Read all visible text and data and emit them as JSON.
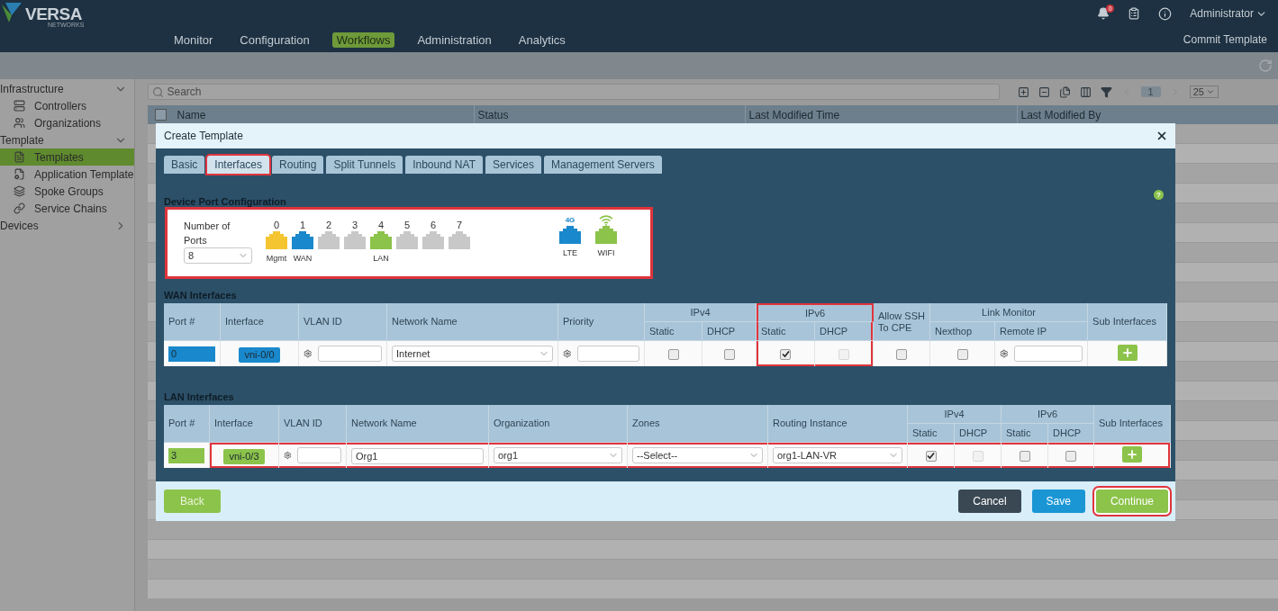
{
  "header": {
    "logo": "VERSA",
    "logo_sub": "NETWORKS",
    "notification_count": "0",
    "user": "Administrator",
    "commit": "Commit Template",
    "nav": [
      {
        "label": "Monitor",
        "selected": false
      },
      {
        "label": "Configuration",
        "selected": false
      },
      {
        "label": "Workflows",
        "selected": true
      },
      {
        "label": "Administration",
        "selected": false
      },
      {
        "label": "Analytics",
        "selected": false
      }
    ]
  },
  "sidebar": [
    {
      "label": "Infrastructure",
      "expanded": true,
      "children": [
        {
          "label": "Controllers",
          "kind": "controllers",
          "selected": false
        },
        {
          "label": "Organizations",
          "kind": "organizations",
          "selected": false
        }
      ]
    },
    {
      "label": "Template",
      "expanded": true,
      "children": [
        {
          "label": "Templates",
          "kind": "templates",
          "selected": true
        },
        {
          "label": "Application Template",
          "kind": "app-template",
          "selected": false
        },
        {
          "label": "Spoke Groups",
          "kind": "spoke-groups",
          "selected": false
        },
        {
          "label": "Service Chains",
          "kind": "service-chains",
          "selected": false
        }
      ]
    },
    {
      "label": "Devices",
      "expanded": false
    }
  ],
  "toolbar": {
    "search_placeholder": "Search",
    "page": "1",
    "page_size": "25"
  },
  "table": {
    "checked": false,
    "columns": [
      "Name",
      "Status",
      "Last Modified Time",
      "Last Modified By"
    ]
  },
  "dialog": {
    "title": "Create Template",
    "help": "?",
    "tabs": [
      {
        "label": "Basic",
        "selected": false,
        "highlighted": false
      },
      {
        "label": "Interfaces",
        "selected": true,
        "highlighted": true
      },
      {
        "label": "Routing",
        "selected": false,
        "highlighted": false
      },
      {
        "label": "Split Tunnels",
        "selected": false,
        "highlighted": false
      },
      {
        "label": "Inbound NAT",
        "selected": false,
        "highlighted": false
      },
      {
        "label": "Services",
        "selected": false,
        "highlighted": false
      },
      {
        "label": "Management Servers",
        "selected": false,
        "highlighted": false
      }
    ],
    "port_config": {
      "title": "Device Port Configuration",
      "highlighted": true,
      "count_label": "Number of Ports",
      "count_value": "8",
      "ports": [
        {
          "number": "0",
          "color": "#f5c531",
          "label": "Mgmt"
        },
        {
          "number": "1",
          "color": "#1a88cc",
          "label": "WAN"
        },
        {
          "number": "2",
          "color": "#c8c8c8"
        },
        {
          "number": "3",
          "color": "#c8c8c8"
        },
        {
          "number": "4",
          "color": "#8cc34a",
          "label": "LAN"
        },
        {
          "number": "5",
          "color": "#c8c8c8"
        },
        {
          "number": "6",
          "color": "#c8c8c8"
        },
        {
          "number": "7",
          "color": "#c8c8c8"
        }
      ],
      "extra_ports": [
        {
          "kind": "lte",
          "label": "LTE",
          "badge": "4G",
          "color": "#1a88cc"
        },
        {
          "kind": "wifi",
          "label": "WIFI",
          "color": "#8cc34a"
        }
      ]
    },
    "wan": {
      "title": "WAN Interfaces",
      "columns": [
        {
          "label": "Port #"
        },
        {
          "label": "Interface"
        },
        {
          "label": "VLAN ID"
        },
        {
          "label": "Network Name"
        },
        {
          "label": "Priority"
        },
        {
          "label": "IPv4",
          "sub": [
            "Static",
            "DHCP"
          ],
          "highlighted": false
        },
        {
          "label": "IPv6",
          "sub": [
            "Static",
            "DHCP"
          ],
          "highlighted": true
        },
        {
          "label": "Allow SSH To CPE"
        },
        {
          "label": "Link Monitor",
          "sub": [
            "Nexthop",
            "Remote IP"
          ],
          "highlighted": false
        },
        {
          "label": "Sub Interfaces"
        }
      ],
      "rows": [
        {
          "highlighted": false,
          "cells": [
            {
              "kind": "port",
              "value": "0",
              "color": "#1a88cc"
            },
            {
              "kind": "tag",
              "value": "vni-0/0",
              "color": "#1a88cc"
            },
            {
              "kind": "gear-input"
            },
            {
              "kind": "select",
              "value": "Internet"
            },
            {
              "kind": "gear-input"
            },
            {
              "kind": "checkbox",
              "checked": false,
              "disabled": false
            },
            {
              "kind": "checkbox",
              "checked": false,
              "disabled": false
            },
            {
              "kind": "checkbox",
              "checked": true,
              "disabled": false
            },
            {
              "kind": "checkbox",
              "checked": false,
              "disabled": true
            },
            {
              "kind": "checkbox",
              "checked": false,
              "disabled": false
            },
            {
              "kind": "checkbox",
              "checked": false,
              "disabled": false
            },
            {
              "kind": "gear-input"
            },
            {
              "kind": "add"
            }
          ]
        }
      ]
    },
    "lan": {
      "title": "LAN Interfaces",
      "columns": [
        {
          "label": "Port #"
        },
        {
          "label": "Interface"
        },
        {
          "label": "VLAN ID"
        },
        {
          "label": "Network Name"
        },
        {
          "label": "Organization"
        },
        {
          "label": "Zones"
        },
        {
          "label": "Routing Instance"
        },
        {
          "label": "IPv4",
          "sub": [
            "Static",
            "DHCP"
          ],
          "highlighted": false
        },
        {
          "label": "IPv6",
          "sub": [
            "Static",
            "DHCP"
          ],
          "highlighted": false
        },
        {
          "label": "Sub Interfaces"
        }
      ],
      "rows": [
        {
          "highlighted": true,
          "cells": [
            {
              "kind": "port",
              "value": "3",
              "color": "#8cc34a"
            },
            {
              "kind": "tag",
              "value": "vni-0/3",
              "color": "#8cc34a"
            },
            {
              "kind": "gear-input"
            },
            {
              "kind": "input",
              "value": "Org1"
            },
            {
              "kind": "select",
              "value": "org1"
            },
            {
              "kind": "select",
              "value": "--Select--"
            },
            {
              "kind": "select",
              "value": "org1-LAN-VR"
            },
            {
              "kind": "checkbox",
              "checked": true,
              "disabled": false
            },
            {
              "kind": "checkbox",
              "checked": false,
              "disabled": true
            },
            {
              "kind": "checkbox",
              "checked": false,
              "disabled": false
            },
            {
              "kind": "checkbox",
              "checked": false,
              "disabled": false
            },
            {
              "kind": "add"
            }
          ]
        }
      ]
    },
    "buttons": [
      {
        "label": "Back",
        "kind": "back",
        "highlighted": false
      },
      {
        "label": "Cancel",
        "kind": "cancel",
        "highlighted": false
      },
      {
        "label": "Save",
        "kind": "save",
        "highlighted": false
      },
      {
        "label": "Continue",
        "kind": "continue",
        "highlighted": true
      }
    ]
  }
}
